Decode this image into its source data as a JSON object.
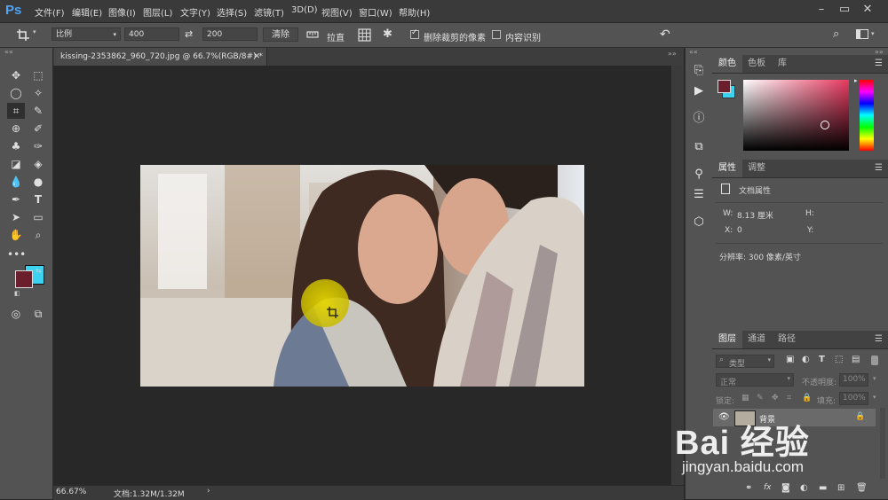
{
  "app": {
    "logo": "Ps"
  },
  "menu": [
    "文件(F)",
    "编辑(E)",
    "图像(I)",
    "图层(L)",
    "文字(Y)",
    "选择(S)",
    "滤镜(T)",
    "3D(D)",
    "视图(V)",
    "窗口(W)",
    "帮助(H)"
  ],
  "options": {
    "ratio": "比例",
    "width": "400",
    "height": "200",
    "clear": "清除",
    "straighten": "拉直",
    "delete_cropped_label": "删除裁剪的像素",
    "delete_cropped_checked": true,
    "content_aware_label": "内容识别",
    "content_aware_checked": false
  },
  "document": {
    "tab_title": "kissing-2353862_960_720.jpg @ 66.7%(RGB/8#) *",
    "zoom": "66.67%",
    "doc_size": "文档:1.32M/1.32M"
  },
  "colors": {
    "foreground": "#6b1f2c",
    "background": "#3cd3f0",
    "picker_hue": "#e8395f"
  },
  "color_panel": {
    "tabs": [
      "颜色",
      "色板",
      "库"
    ]
  },
  "properties_panel": {
    "tabs": [
      "属性",
      "调整"
    ],
    "title": "文档属性",
    "w_label": "W:",
    "w_value": "8.13 厘米",
    "h_label": "H:",
    "x_label": "X:",
    "x_value": "0",
    "y_label": "Y:",
    "resolution": "分辨率: 300 像素/英寸"
  },
  "layers_panel": {
    "tabs": [
      "图层",
      "通道",
      "路径"
    ],
    "filter": "类型",
    "blend_mode": "正常",
    "opacity_label": "不透明度:",
    "opacity_value": "100%",
    "lock_label": "锁定:",
    "fill_label": "填充:",
    "fill_value": "100%",
    "layer_name": "背景"
  },
  "watermark": {
    "brand": "Bai 经验",
    "url": "jingyan.baidu.com"
  }
}
